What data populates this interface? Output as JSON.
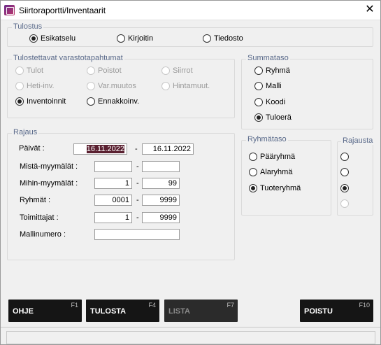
{
  "window": {
    "title": "Siirtoraportti/Inventaarit"
  },
  "tulostus": {
    "legend": "Tulostus",
    "options": [
      {
        "label": "Esikatselu",
        "checked": true
      },
      {
        "label": "Kirjoitin",
        "checked": false
      },
      {
        "label": "Tiedosto",
        "checked": false
      }
    ]
  },
  "tapahtumat": {
    "legend": "Tulostettavat varastotapahtumat",
    "options": [
      {
        "label": "Tulot",
        "checked": false,
        "enabled": false
      },
      {
        "label": "Poistot",
        "checked": false,
        "enabled": false
      },
      {
        "label": "Siirrot",
        "checked": false,
        "enabled": false
      },
      {
        "label": "Heti-inv.",
        "checked": false,
        "enabled": false
      },
      {
        "label": "Var.muutos",
        "checked": false,
        "enabled": false
      },
      {
        "label": "Hintamuut.",
        "checked": false,
        "enabled": false
      },
      {
        "label": "Inventoinnit",
        "checked": true,
        "enabled": true
      },
      {
        "label": "Ennakkoinv.",
        "checked": false,
        "enabled": true
      }
    ]
  },
  "summataso": {
    "legend": "Summataso",
    "options": [
      {
        "label": "Ryhmä",
        "checked": false
      },
      {
        "label": "Malli",
        "checked": false
      },
      {
        "label": "Koodi",
        "checked": false
      },
      {
        "label": "Tuloerä",
        "checked": true
      }
    ]
  },
  "rajaus": {
    "legend": "Rajaus",
    "paivat": {
      "label": "Päivät :",
      "from": "16.11.2022",
      "to": "16.11.2022"
    },
    "mista": {
      "label": "Mistä-myymälät :",
      "from": "",
      "to": ""
    },
    "mihin": {
      "label": "Mihin-myymälät :",
      "from": "1",
      "to": "99"
    },
    "ryhmat": {
      "label": "Ryhmät :",
      "from": "0001",
      "to": "9999"
    },
    "toimittajat": {
      "label": "Toimittajat :",
      "from": "1",
      "to": "9999"
    },
    "mallinumero": {
      "label": "Mallinumero :",
      "value": ""
    },
    "separator": "-"
  },
  "ryhmataso": {
    "legend": "Ryhmätaso",
    "options": [
      {
        "label": "Pääryhmä",
        "checked": false
      },
      {
        "label": "Alaryhmä",
        "checked": false
      },
      {
        "label": "Tuoteryhmä",
        "checked": true
      }
    ]
  },
  "rajausta": {
    "legend": "Rajausta",
    "options": [
      {
        "checked": false,
        "enabled": true
      },
      {
        "checked": false,
        "enabled": true
      },
      {
        "checked": true,
        "enabled": true
      },
      {
        "checked": false,
        "enabled": false
      }
    ]
  },
  "buttons": {
    "ohje": {
      "label": "OHJE",
      "key": "F1"
    },
    "tulosta": {
      "label": "TULOSTA",
      "key": "F4"
    },
    "lista": {
      "label": "LISTA",
      "key": "F7"
    },
    "poistu": {
      "label": "POISTU",
      "key": "F10"
    }
  }
}
